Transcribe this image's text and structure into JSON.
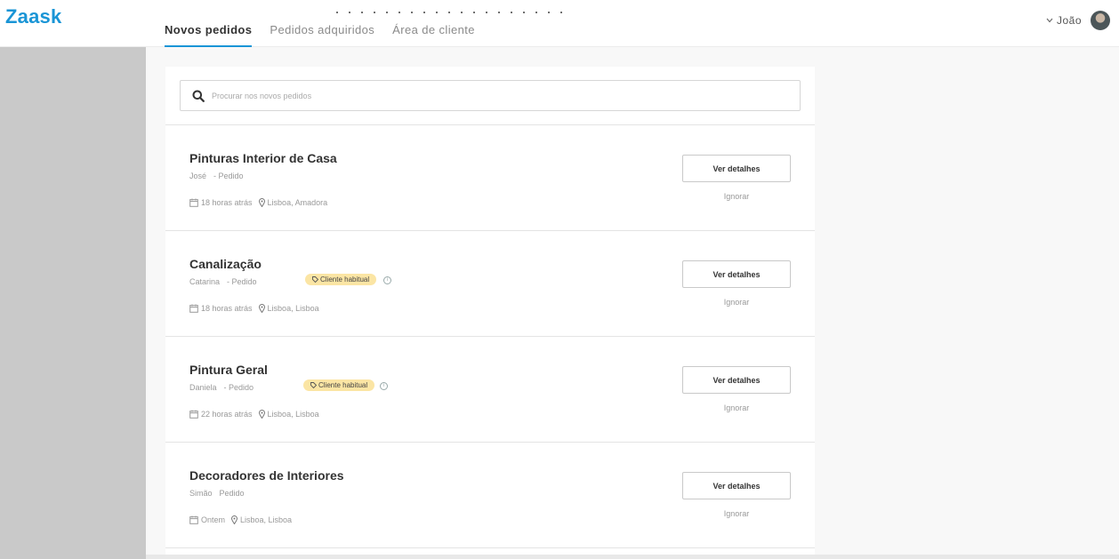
{
  "brand": {
    "logo_text": "Zaask",
    "accent": "#1a95d6"
  },
  "nav": {
    "tabs": [
      {
        "label": "Novos pedidos",
        "active": true
      },
      {
        "label": "Pedidos adquiridos",
        "active": false
      },
      {
        "label": "Área de cliente",
        "active": false
      }
    ]
  },
  "user": {
    "name": "João",
    "menu_icon": "chevron-down-icon"
  },
  "search": {
    "placeholder": "Procurar nos novos pedidos",
    "icon": "search-icon"
  },
  "orders": [
    {
      "title": "Pinturas Interior de Casa",
      "client": "José",
      "type": "- Pedido",
      "badge": "",
      "time": "18 horas atrás",
      "location": "Lisboa, Amadora",
      "details_label": "Ver detalhes",
      "ignore_label": "Ignorar"
    },
    {
      "title": "Canalização",
      "client": "Catarina",
      "type": "- Pedido",
      "badge": "Cliente habitual",
      "time": "18 horas atrás",
      "location": "Lisboa, Lisboa",
      "details_label": "Ver detalhes",
      "ignore_label": "Ignorar"
    },
    {
      "title": "Pintura Geral",
      "client": "Daniela",
      "type": "- Pedido",
      "badge": "Cliente habitual",
      "time": "22 horas atrás",
      "location": "Lisboa, Lisboa",
      "details_label": "Ver detalhes",
      "ignore_label": "Ignorar"
    },
    {
      "title": "Decoradores de Interiores",
      "client": "Simão",
      "type": "Pedido",
      "badge": "",
      "time": "Ontem",
      "location": "Lisboa, Lisboa",
      "details_label": "Ver detalhes",
      "ignore_label": "Ignorar"
    }
  ],
  "badge_color": "#fbe5a4"
}
